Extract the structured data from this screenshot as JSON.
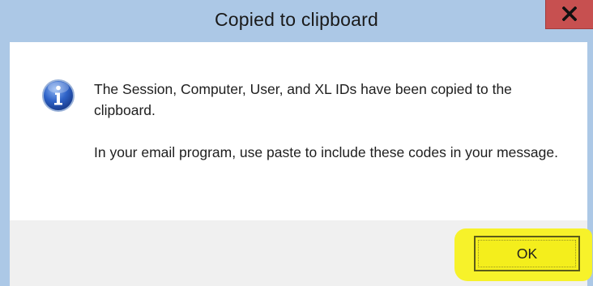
{
  "dialog": {
    "title": "Copied to clipboard",
    "close_icon": "close-icon",
    "message_line1": "The Session, Computer, User, and XL IDs have been copied to the clipboard.",
    "message_line2": "In your email program, use paste to include these codes in your message.",
    "info_icon": "info-icon",
    "ok_label": "OK"
  },
  "colors": {
    "titlebar": "#acc8e6",
    "close_button": "#c75050",
    "highlight": "#f7f22a",
    "footer": "#f0f0f0"
  }
}
